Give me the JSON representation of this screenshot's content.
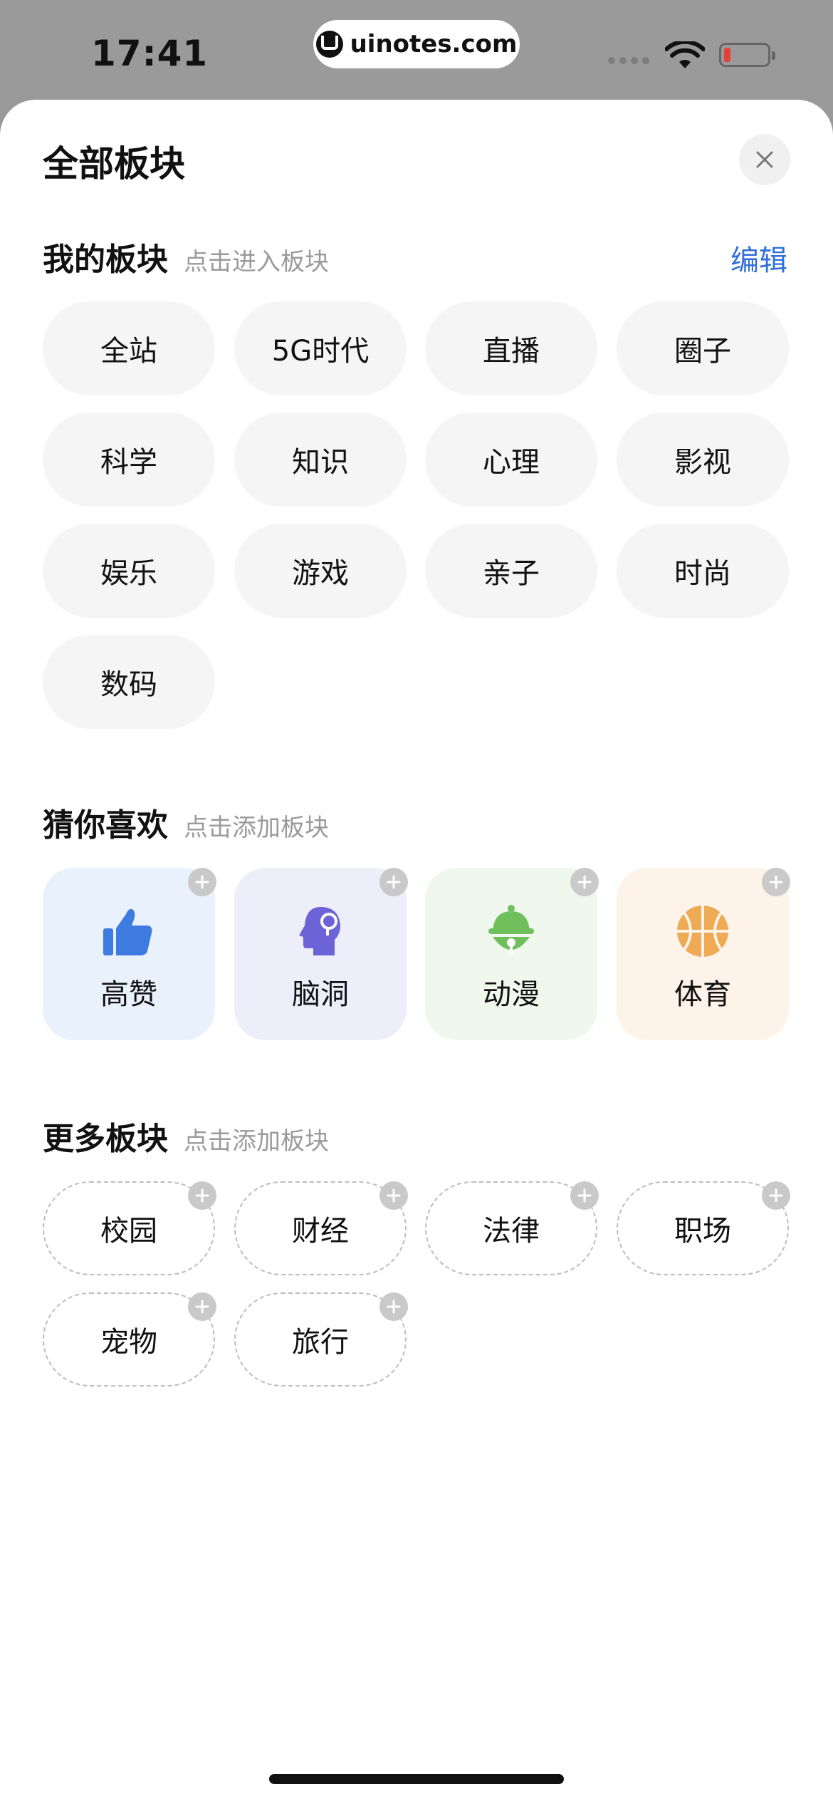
{
  "status_bar": {
    "time": "17:41",
    "url": "uinotes.com",
    "battery_level": 0.15
  },
  "sheet": {
    "title": "全部板块"
  },
  "my_sections": {
    "title": "我的板块",
    "hint": "点击进入板块",
    "edit_label": "编辑",
    "items": [
      "全站",
      "5G时代",
      "直播",
      "圈子",
      "科学",
      "知识",
      "心理",
      "影视",
      "娱乐",
      "游戏",
      "亲子",
      "时尚",
      "数码"
    ]
  },
  "recommended": {
    "title": "猜你喜欢",
    "hint": "点击添加板块",
    "items": [
      {
        "label": "高赞",
        "icon": "thumbs-up-icon",
        "bg": "#e9f1fd",
        "icon_color": "#3e7be0"
      },
      {
        "label": "脑洞",
        "icon": "brain-head-icon",
        "bg": "#eeeefb",
        "icon_color": "#6b63d6"
      },
      {
        "label": "动漫",
        "icon": "bell-icon",
        "bg": "#f0f8ee",
        "icon_color": "#6fc05d"
      },
      {
        "label": "体育",
        "icon": "basketball-icon",
        "bg": "#fdf3e9",
        "icon_color": "#eeaa55"
      }
    ]
  },
  "more_sections": {
    "title": "更多板块",
    "hint": "点击添加板块",
    "items": [
      "校园",
      "财经",
      "法律",
      "职场",
      "宠物",
      "旅行"
    ]
  }
}
